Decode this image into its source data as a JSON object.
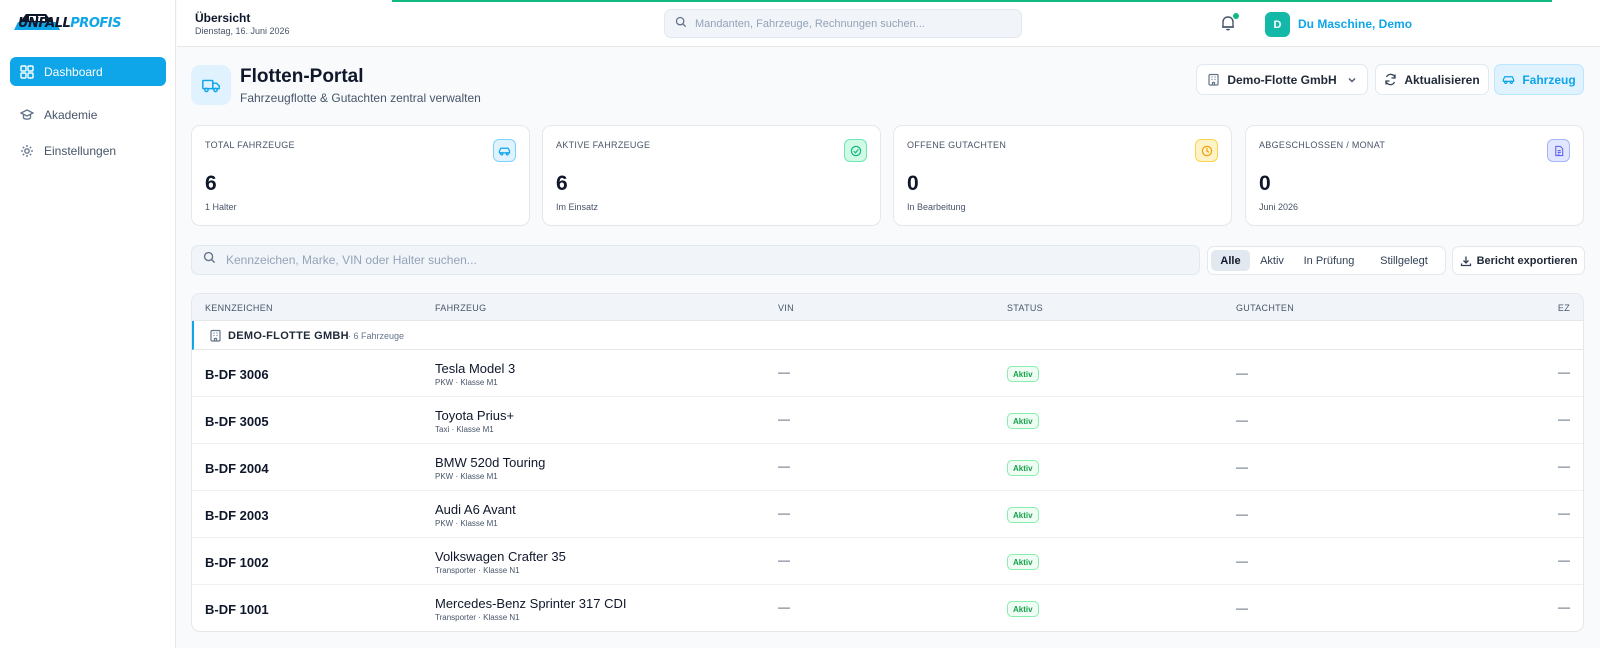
{
  "brand": {
    "logo_text_a": "UNFALL",
    "logo_text_b": "PROFIS"
  },
  "sidebar": {
    "items": [
      {
        "label": "Dashboard",
        "icon": "grid-icon",
        "active": true
      },
      {
        "label": "Akademie",
        "icon": "graduation-cap-icon",
        "active": false
      },
      {
        "label": "Einstellungen",
        "icon": "gear-icon",
        "active": false
      }
    ]
  },
  "topbar": {
    "title": "Übersicht",
    "date": "Dienstag, 16. Juni 2026",
    "search_placeholder": "Mandanten, Fahrzeuge, Rechnungen suchen...",
    "user_initial": "D",
    "user_name": "Du Maschine, Demo",
    "notification_dot_color": "#10b981"
  },
  "header": {
    "title": "Flotten-Portal",
    "subtitle": "Fahrzeugflotte & Gutachten zentral verwalten",
    "org_select": "Demo-Flotte GmbH",
    "refresh_label": "Aktualisieren",
    "add_label": "Fahrzeug"
  },
  "stats": [
    {
      "label": "TOTAL FAHRZEUGE",
      "value": "6",
      "sub": "1 Halter",
      "icon": "car-icon",
      "color": "#0ea5e9"
    },
    {
      "label": "AKTIVE FAHRZEUGE",
      "value": "6",
      "sub": "Im Einsatz",
      "icon": "check-circle-icon",
      "color": "#10b981"
    },
    {
      "label": "OFFENE GUTACHTEN",
      "value": "0",
      "sub": "In Bearbeitung",
      "icon": "clock-icon",
      "color": "#f59e0b"
    },
    {
      "label": "ABGESCHLOSSEN / MONAT",
      "value": "0",
      "sub": "Juni 2026",
      "icon": "document-icon",
      "color": "#6366f1"
    }
  ],
  "filter": {
    "search_placeholder": "Kennzeichen, Marke, VIN oder Halter suchen...",
    "tabs": [
      "Alle",
      "Aktiv",
      "In Prüfung",
      "Stillgelegt"
    ],
    "active_tab": "Alle",
    "export_label": "Bericht exportieren"
  },
  "table": {
    "columns": [
      "KENNZEICHEN",
      "FAHRZEUG",
      "VIN",
      "STATUS",
      "GUTACHTEN",
      "EZ"
    ],
    "group": {
      "name": "DEMO-FLOTTE GMBH",
      "count": "· 6 Fahrzeuge"
    },
    "rows": [
      {
        "plate": "B-DF 3006",
        "model": "Tesla Model 3",
        "category": "PKW · Klasse M1",
        "vin": "—",
        "status": "Aktiv",
        "gutachten": "—",
        "ez": "—"
      },
      {
        "plate": "B-DF 3005",
        "model": "Toyota Prius+",
        "category": "Taxi · Klasse M1",
        "vin": "—",
        "status": "Aktiv",
        "gutachten": "—",
        "ez": "—"
      },
      {
        "plate": "B-DF 2004",
        "model": "BMW 520d Touring",
        "category": "PKW · Klasse M1",
        "vin": "—",
        "status": "Aktiv",
        "gutachten": "—",
        "ez": "—"
      },
      {
        "plate": "B-DF 2003",
        "model": "Audi A6 Avant",
        "category": "PKW · Klasse M1",
        "vin": "—",
        "status": "Aktiv",
        "gutachten": "—",
        "ez": "—"
      },
      {
        "plate": "B-DF 1002",
        "model": "Volkswagen Crafter 35",
        "category": "Transporter · Klasse N1",
        "vin": "—",
        "status": "Aktiv",
        "gutachten": "—",
        "ez": "—"
      },
      {
        "plate": "B-DF 1001",
        "model": "Mercedes-Benz Sprinter 317 CDI",
        "category": "Transporter · Klasse N1",
        "vin": "—",
        "status": "Aktiv",
        "gutachten": "—",
        "ez": "—"
      }
    ]
  }
}
